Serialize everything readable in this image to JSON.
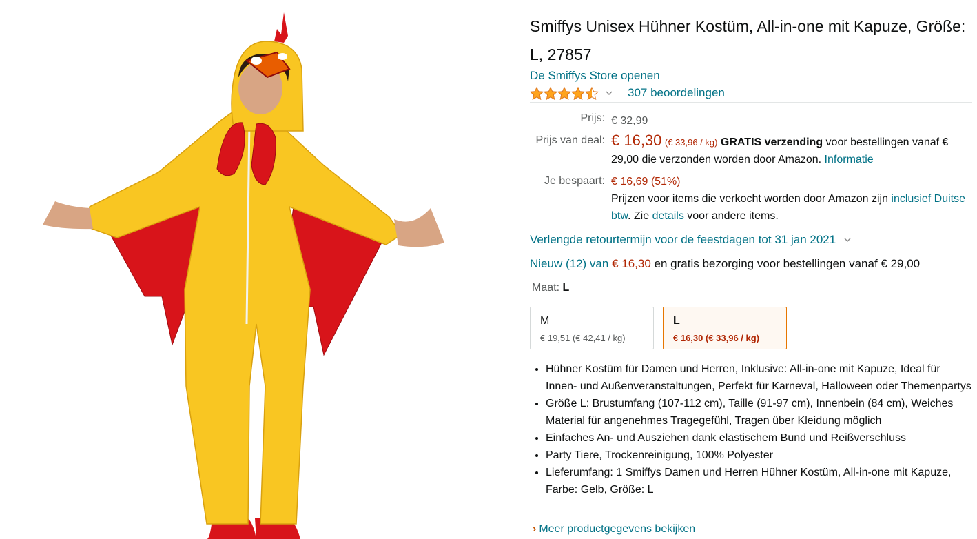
{
  "product": {
    "title": "Smiffys Unisex Hühner Kostüm, All-in-one mit Kapuze, Größe: L, 27857",
    "store_link": "De Smiffys Store openen",
    "rating": 4.5,
    "ratings_count": "307 beoordelingen"
  },
  "price": {
    "list_label": "Prijs:",
    "list_price": "€ 32,99",
    "deal_label": "Prijs van deal:",
    "deal_price": "€ 16,30",
    "unit_price": "(€ 33,96 / kg)",
    "free_shipping": "GRATIS verzending",
    "shipping_text1": " voor bestellingen vanaf € 29,00 die verzonden worden door Amazon. ",
    "info_link": "Informatie",
    "save_label": "Je bespaart:",
    "savings": "€ 16,69 (51%)",
    "tax_text1": "Prijzen voor items die verkocht worden door Amazon zijn ",
    "tax_link": "inclusief Duitse btw",
    "tax_text2": ". Zie ",
    "details_link": "details",
    "tax_text3": " voor andere items."
  },
  "returns_text": "Verlengde retourtermijn voor de feestdagen tot 31 jan 2021",
  "offers": {
    "link": "Nieuw (12) van",
    "price": "€ 16,30",
    "text": " en gratis bezorging voor bestellingen vanaf € 29,00"
  },
  "size": {
    "label": "Maat:",
    "selected": "L",
    "options": [
      {
        "name": "M",
        "price": "€ 19,51 (€ 42,41 / kg)"
      },
      {
        "name": "L",
        "price": "€ 16,30 (€ 33,96 / kg)"
      }
    ]
  },
  "bullets": [
    "Hühner Kostüm für Damen und Herren, Inklusive: All-in-one mit Kapuze, Ideal für Innen- und Außenveranstaltungen, Perfekt für Karneval, Halloween oder Themenpartys",
    "Größe L: Brustumfang (107-112 cm), Taille (91-97 cm), Innenbein (84 cm), Weiches Material für angenehmes Tragegefühl, Tragen über Kleidung möglich",
    "Einfaches An- und Ausziehen dank elastischem Bund und Reißverschluss",
    "Party Tiere, Trockenreinigung, 100% Polyester",
    "Lieferumfang: 1 Smiffys Damen und Herren Hühner Kostüm, All-in-one mit Kapuze, Farbe: Gelb, Größe: L"
  ],
  "more_link": "Meer productgegevens bekijken",
  "colors": {
    "link": "#007185",
    "price_red": "#B12704",
    "star": "#FFA41C",
    "selected_border": "#E77600",
    "costume_yellow": "#F9C622",
    "costume_red": "#D8141A"
  }
}
